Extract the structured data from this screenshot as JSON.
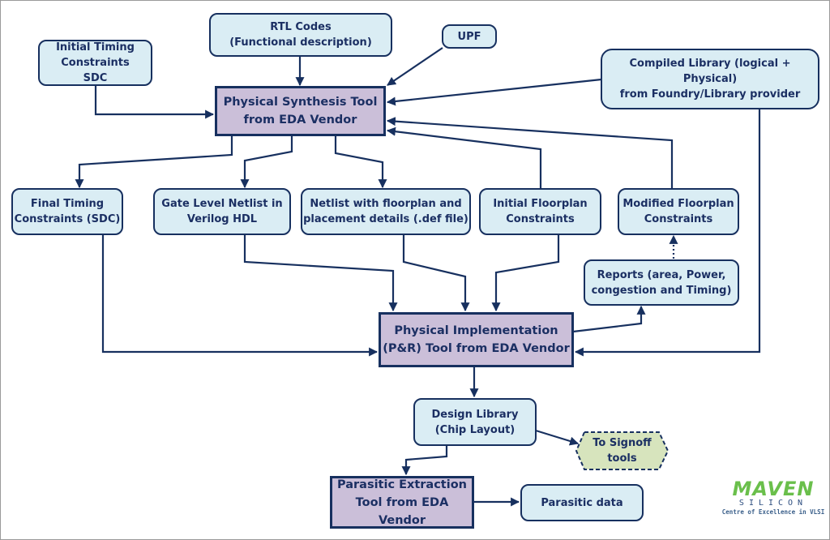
{
  "nodes": {
    "initial_timing": "Initial Timing\nConstraints\nSDC",
    "rtl": "RTL Codes\n(Functional description)",
    "upf": "UPF",
    "compiled_library": "Compiled Library (logical + Physical)\nfrom Foundry/Library provider",
    "synthesis_tool": "Physical Synthesis Tool\nfrom EDA Vendor",
    "final_timing": "Final Timing\nConstraints (SDC)",
    "gate_netlist": "Gate Level Netlist in\nVerilog HDL",
    "netlist_floorplan": "Netlist with floorplan and\nplacement details (.def file)",
    "initial_floorplan": "Initial Floorplan\nConstraints",
    "modified_floorplan": "Modified Floorplan\nConstraints",
    "reports": "Reports (area, Power,\ncongestion and Timing)",
    "pnr_tool": "Physical Implementation\n(P&R) Tool from EDA Vendor",
    "design_library": "Design Library\n(Chip Layout)",
    "signoff": "To Signoff\ntools",
    "parasitic_tool": "Parasitic Extraction\nTool from EDA Vendor",
    "parasitic_data": "Parasitic data"
  },
  "logo": {
    "brand": "MAVEN",
    "sub": "SILICON",
    "tagline": "Centre of Excellence in VLSI"
  },
  "colors": {
    "box_fill": "#daedf4",
    "tool_fill": "#cbbfd9",
    "signoff_fill": "#d7e4bd",
    "line": "#17305f",
    "logo_green": "#6abf4b"
  }
}
